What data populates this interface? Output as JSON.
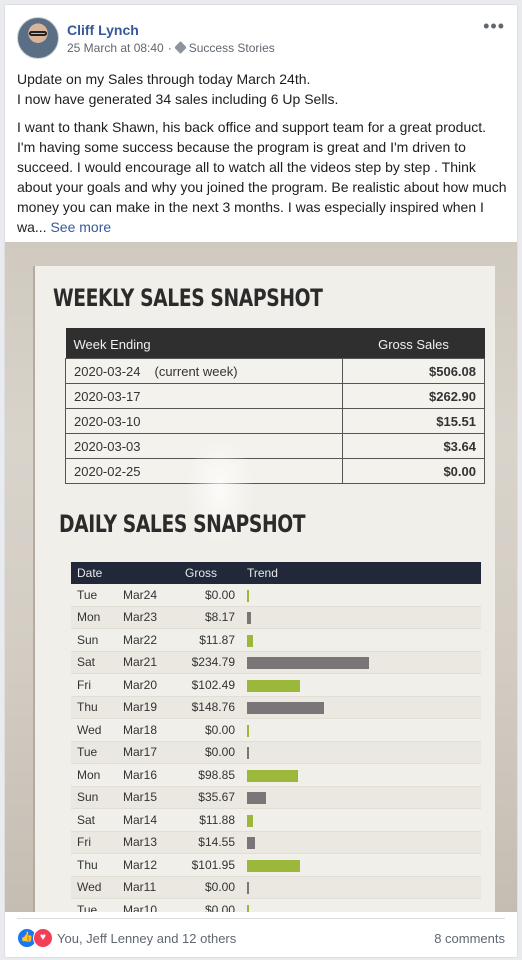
{
  "post": {
    "author": "Cliff Lynch",
    "timestamp": "25 March at 08:40",
    "separator": "·",
    "group": "Success Stories",
    "more_icon": "•••",
    "paragraph1_line1": "Update on my Sales through today March 24th.",
    "paragraph1_line2": "I now have generated 34 sales including 6 Up Sells.",
    "paragraph2": "I want to thank Shawn, his back office and support team for a great product. I'm having some success because the program is great and I'm driven to succeed. I would encourage all to watch all the videos step by step . Think about your goals and why you joined the program. Be realistic about how much money you can make in the next 3 months. I was especially inspired when I wa...",
    "see_more": "See more"
  },
  "weekly": {
    "title": "WEEKLY SALES SNAPSHOT",
    "col_week": "Week Ending",
    "col_gross": "Gross Sales",
    "rows": [
      {
        "week": "2020-03-24",
        "note": "(current week)",
        "amount": "$506.08"
      },
      {
        "week": "2020-03-17",
        "note": "",
        "amount": "$262.90"
      },
      {
        "week": "2020-03-10",
        "note": "",
        "amount": "$15.51"
      },
      {
        "week": "2020-03-03",
        "note": "",
        "amount": "$3.64"
      },
      {
        "week": "2020-02-25",
        "note": "",
        "amount": "$0.00"
      }
    ]
  },
  "daily": {
    "title": "DAILY SALES SNAPSHOT",
    "col_date": "Date",
    "col_gross": "Gross",
    "col_trend": "Trend",
    "bar_colors": {
      "gray": "#7a7577",
      "green": "#9cb83a"
    },
    "rows": [
      {
        "day": "Tue",
        "date": "Mar24",
        "gross": "$0.00",
        "value": 0.0,
        "color": "green"
      },
      {
        "day": "Mon",
        "date": "Mar23",
        "gross": "$8.17",
        "value": 8.17,
        "color": "gray"
      },
      {
        "day": "Sun",
        "date": "Mar22",
        "gross": "$11.87",
        "value": 11.87,
        "color": "green"
      },
      {
        "day": "Sat",
        "date": "Mar21",
        "gross": "$234.79",
        "value": 234.79,
        "color": "gray"
      },
      {
        "day": "Fri",
        "date": "Mar20",
        "gross": "$102.49",
        "value": 102.49,
        "color": "green"
      },
      {
        "day": "Thu",
        "date": "Mar19",
        "gross": "$148.76",
        "value": 148.76,
        "color": "gray"
      },
      {
        "day": "Wed",
        "date": "Mar18",
        "gross": "$0.00",
        "value": 0.0,
        "color": "green"
      },
      {
        "day": "Tue",
        "date": "Mar17",
        "gross": "$0.00",
        "value": 0.0,
        "color": "gray"
      },
      {
        "day": "Mon",
        "date": "Mar16",
        "gross": "$98.85",
        "value": 98.85,
        "color": "green"
      },
      {
        "day": "Sun",
        "date": "Mar15",
        "gross": "$35.67",
        "value": 35.67,
        "color": "gray"
      },
      {
        "day": "Sat",
        "date": "Mar14",
        "gross": "$11.88",
        "value": 11.88,
        "color": "green"
      },
      {
        "day": "Fri",
        "date": "Mar13",
        "gross": "$14.55",
        "value": 14.55,
        "color": "gray"
      },
      {
        "day": "Thu",
        "date": "Mar12",
        "gross": "$101.95",
        "value": 101.95,
        "color": "green"
      },
      {
        "day": "Wed",
        "date": "Mar11",
        "gross": "$0.00",
        "value": 0.0,
        "color": "gray"
      },
      {
        "day": "Tue",
        "date": "Mar10",
        "gross": "$0.00",
        "value": 0.0,
        "color": "green"
      }
    ]
  },
  "footer": {
    "like_icon": "like-icon",
    "love_icon": "love-icon",
    "reactions_text": "You, Jeff Lenney and 12 others",
    "comments": "8 comments"
  }
}
